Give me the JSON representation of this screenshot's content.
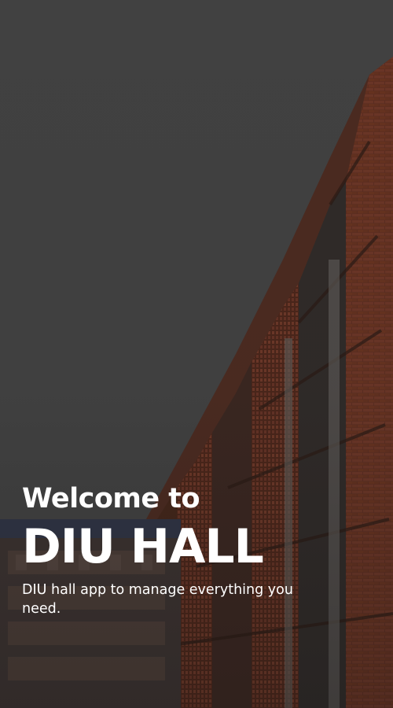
{
  "splash": {
    "welcome_text": "Welcome to",
    "app_name": "DIU HALL",
    "tagline": "DIU hall app to manage everything you need.",
    "background_image": "building-photo"
  },
  "colors": {
    "overlay": "#404040",
    "text": "#ffffff",
    "brick": "#7a3a26"
  }
}
